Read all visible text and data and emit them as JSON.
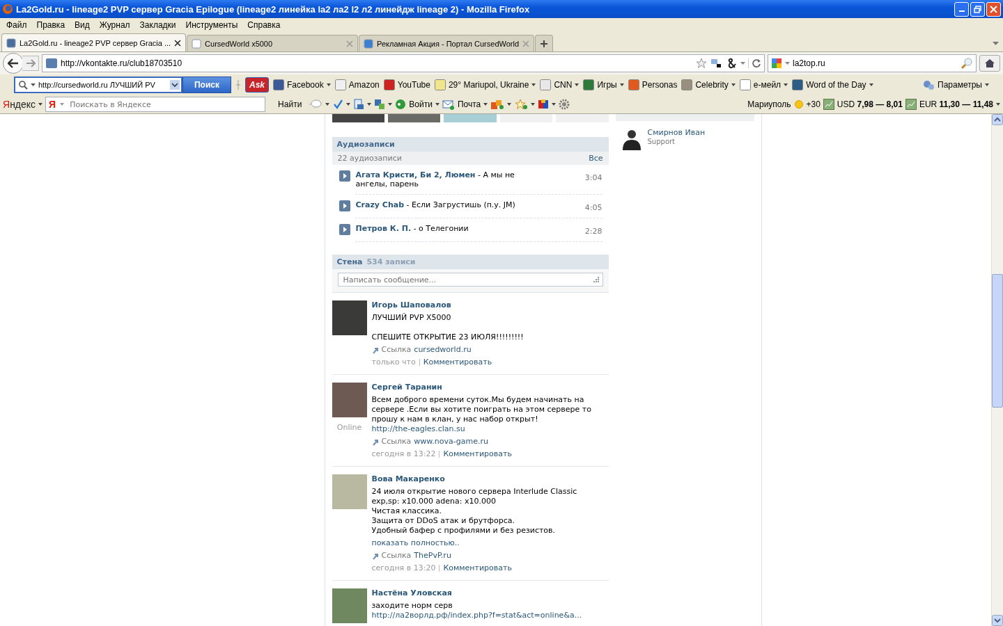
{
  "window": {
    "title": "La2Gold.ru - lineage2 PVP сервер Gracia Epilogue (lineage2 линейка la2 ла2 l2 л2 линейдж lineage 2) - Mozilla Firefox"
  },
  "menu": [
    "Файл",
    "Правка",
    "Вид",
    "Журнал",
    "Закладки",
    "Инструменты",
    "Справка"
  ],
  "tabs": [
    {
      "label": "La2Gold.ru - lineage2 PVP сервер Gracia ...",
      "selected": true,
      "kind": "vk"
    },
    {
      "label": "CursedWorld x5000",
      "selected": false,
      "kind": "page"
    },
    {
      "label": "Рекламная Акция - Портал CursedWorld",
      "selected": false,
      "kind": "portal"
    }
  ],
  "nav": {
    "url": "http://vkontakte.ru/club18703510",
    "search": "la2top.ru"
  },
  "ask_toolbar": {
    "query": "http://cursedworld.ru ЛУЧШИЙ PV",
    "button": "Поиск",
    "logo": "Ask",
    "settings": "Параметры",
    "items": [
      {
        "label": "Facebook",
        "menu": true,
        "color": "#3b5998"
      },
      {
        "label": "Amazon",
        "menu": false,
        "color": "#f0f0f0"
      },
      {
        "label": "YouTube",
        "menu": false,
        "color": "#cc2222"
      },
      {
        "label": "29° Mariupol, Ukraine",
        "menu": true,
        "color": "#f2e48a"
      },
      {
        "label": "CNN",
        "menu": true,
        "color": "#e8e8e8"
      },
      {
        "label": "Игры",
        "menu": true,
        "color": "#2d7a3a"
      },
      {
        "label": "Personas",
        "menu": false,
        "color": "#e2591e"
      },
      {
        "label": "Celebrity",
        "menu": true,
        "color": "#9a8f7e"
      },
      {
        "label": "e-мейл",
        "menu": true,
        "color": "#ffffff"
      },
      {
        "label": "Word of the Day",
        "menu": true,
        "color": "#2b5c85"
      }
    ]
  },
  "yandex_bar": {
    "logo": "Яндекс",
    "search_logo": "Я",
    "placeholder": "Поискать в Яндексе",
    "find": "Найти",
    "login": "Войти",
    "mail": "Почта",
    "city": "Мариуполь",
    "temperature": "+30",
    "rates": [
      {
        "currency": "USD",
        "rate": "7,98 — 8,01"
      },
      {
        "currency": "EUR",
        "rate": "11,30 — 11,48"
      }
    ]
  },
  "audio": {
    "title": "Аудиозаписи",
    "count": "22 аудиозаписи",
    "all": "Все",
    "tracks": [
      {
        "artist": "Агата Кристи, Би 2, Люмен",
        "title": " - А мы не ангелы, парень",
        "duration": "3:04"
      },
      {
        "artist": "Crazy Chab",
        "title": " - Если Загрустишь (п.у. JM)",
        "duration": "4:05"
      },
      {
        "artist": "Петров К. П.",
        "title": " - о Телегонии",
        "duration": "2:28"
      }
    ]
  },
  "wall": {
    "title": "Стена",
    "count": "534 записи",
    "placeholder": "Написать сообщение...",
    "posts": [
      {
        "author": "Игорь Шаповалов",
        "text": "ЛУЧШИЙ PVP X5000\n\nСПЕШИТЕ ОТКРЫТИЕ 23 ИЮЛЯ!!!!!!!!!",
        "link_label": "Ссылка",
        "link": "cursedworld.ru",
        "time": "только что",
        "comment": "Комментировать"
      },
      {
        "author": "Сергей Таранин",
        "status": "Online",
        "text": "Всем доброго времени суток.Мы будем начинать на сервере .Если вы хотите поиграть на этом сервере то прошу к нам в клан, у нас набор открыт! ",
        "inline_link": "http://the-eagles.clan.su",
        "link_label": "Ссылка",
        "link": "www.nova-game.ru",
        "time": "сегодня в 13:22",
        "comment": "Комментировать"
      },
      {
        "author": "Вова Макаренко",
        "text": "24 июля открытие нового сервера Interlude Classic\nexp,sp: x10.000 adena: x10.000\nЧистая классика.\nЗащита от DDoS атак и брутфорса.\nУдобный бафер с профилями и без резистов.",
        "more": "показать полностью..",
        "link_label": "Ссылка",
        "link": "ThePvP.ru",
        "time": "сегодня в 13:20",
        "comment": "Комментировать"
      },
      {
        "author": "Настёна Уловская",
        "text": "заходите норм серв ",
        "inline_link": "http://ла2ворлд.рф/index.php?f=stat&act=online&a..."
      }
    ]
  },
  "leader": {
    "name": "Смирнов Иван",
    "role": "Support"
  }
}
